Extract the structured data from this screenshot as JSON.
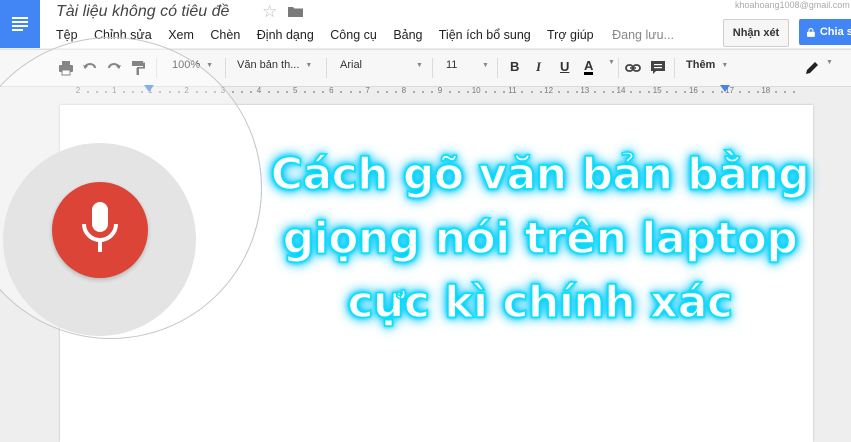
{
  "header": {
    "doc_title": "Tài liệu không có tiêu đề",
    "account_email": "khoahoang1008@gmail.com",
    "comments_label": "Nhận xét",
    "share_label": "Chia sẻ"
  },
  "menu": {
    "items": [
      "Tệp",
      "Chỉnh sửa",
      "Xem",
      "Chèn",
      "Định dạng",
      "Công cụ",
      "Bảng",
      "Tiện ích bổ sung",
      "Trợ giúp"
    ],
    "status": "Đang lưu..."
  },
  "toolbar": {
    "zoom": "100%",
    "style": "Văn bản th...",
    "font": "Arial",
    "font_size": "11",
    "bold": "B",
    "italic": "I",
    "underline": "U",
    "text_color": "A",
    "more": "Thêm"
  },
  "ruler": {
    "numbers": [
      "2",
      "1",
      "1",
      "2",
      "3",
      "4",
      "5",
      "6",
      "7",
      "8",
      "9",
      "10",
      "11",
      "12",
      "13",
      "14",
      "15",
      "16",
      "17",
      "18"
    ]
  },
  "overlay": {
    "headline_lines": [
      "Cách gõ văn bản bằng",
      "giọng nói trên laptop",
      "cực kì chính xác"
    ]
  },
  "colors": {
    "accent": "#4285f4",
    "mic": "#db4437",
    "headline_glow": "#00d8ff"
  }
}
